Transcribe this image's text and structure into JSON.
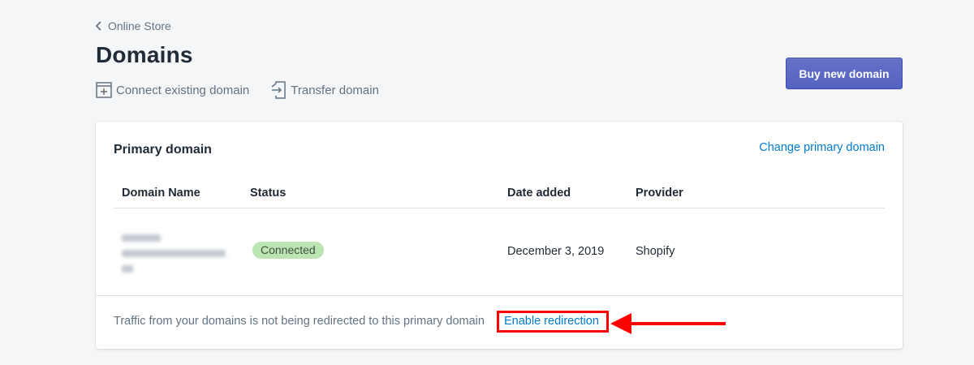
{
  "breadcrumb": {
    "label": "Online Store",
    "icon": "chevron-left-icon"
  },
  "page": {
    "title": "Domains"
  },
  "actions": {
    "connect_label": "Connect existing domain",
    "connect_icon": "connect-domain-icon",
    "transfer_label": "Transfer domain",
    "transfer_icon": "transfer-domain-icon"
  },
  "buy_button": {
    "label": "Buy new domain"
  },
  "card": {
    "title": "Primary domain",
    "change_link": "Change primary domain",
    "columns": [
      "Domain Name",
      "Status",
      "Date added",
      "Provider"
    ],
    "row": {
      "status": "Connected",
      "date_added": "December 3, 2019",
      "provider": "Shopify"
    },
    "footer_text": "Traffic from your domains is not being redirected to this primary domain",
    "enable_link": "Enable redirection"
  },
  "colors": {
    "accent": "#5c6ac4",
    "link": "#007ace",
    "badge_bg": "#bbe5b3",
    "highlight": "#ff0000"
  }
}
